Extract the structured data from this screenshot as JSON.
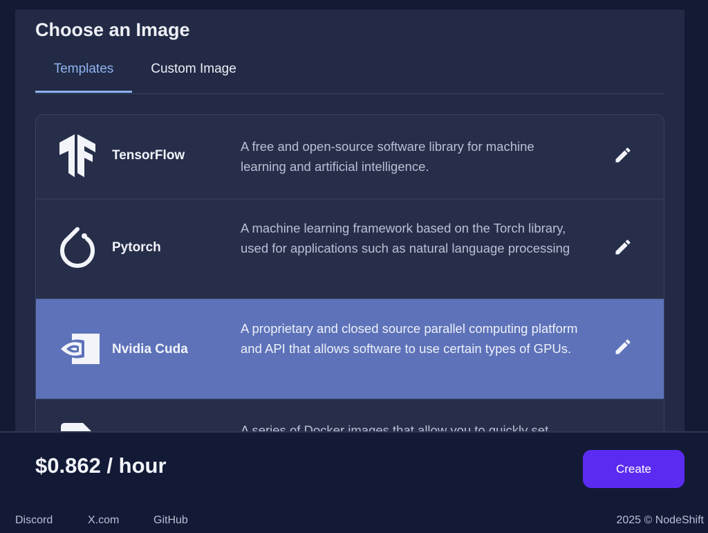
{
  "section": {
    "title": "Choose an Image"
  },
  "tabs": [
    {
      "label": "Templates",
      "active": true
    },
    {
      "label": "Custom Image",
      "active": false
    }
  ],
  "templates": [
    {
      "name": "TensorFlow",
      "description": "A free and open-source software library for machine learning and artificial intelligence.",
      "icon": "tensorflow-logo-icon",
      "selected": false
    },
    {
      "name": "Pytorch",
      "description": "A machine learning framework based on the Torch library, used for applications such as natural language processing",
      "icon": "pytorch-logo-icon",
      "selected": false
    },
    {
      "name": "Nvidia Cuda",
      "description": "A proprietary and closed source parallel computing platform and API that allows software to use certain types of GPUs.",
      "icon": "nvidia-logo-icon",
      "selected": true
    },
    {
      "name": "",
      "description": "A series of Docker images that allow you to quickly set",
      "icon": "docker-logo-icon",
      "selected": false
    }
  ],
  "edit_icon": "pencil-icon",
  "footer": {
    "price": "$0.862 / hour",
    "create_label": "Create",
    "links": [
      "Discord",
      "X.com",
      "GitHub"
    ],
    "copyright": "2025 © NodeShift"
  },
  "colors": {
    "background": "#141a33",
    "panel": "#222a45",
    "selected_row": "#5d72b8",
    "active_tab": "#8fb3ef",
    "create_button": "#5b2bf2"
  }
}
